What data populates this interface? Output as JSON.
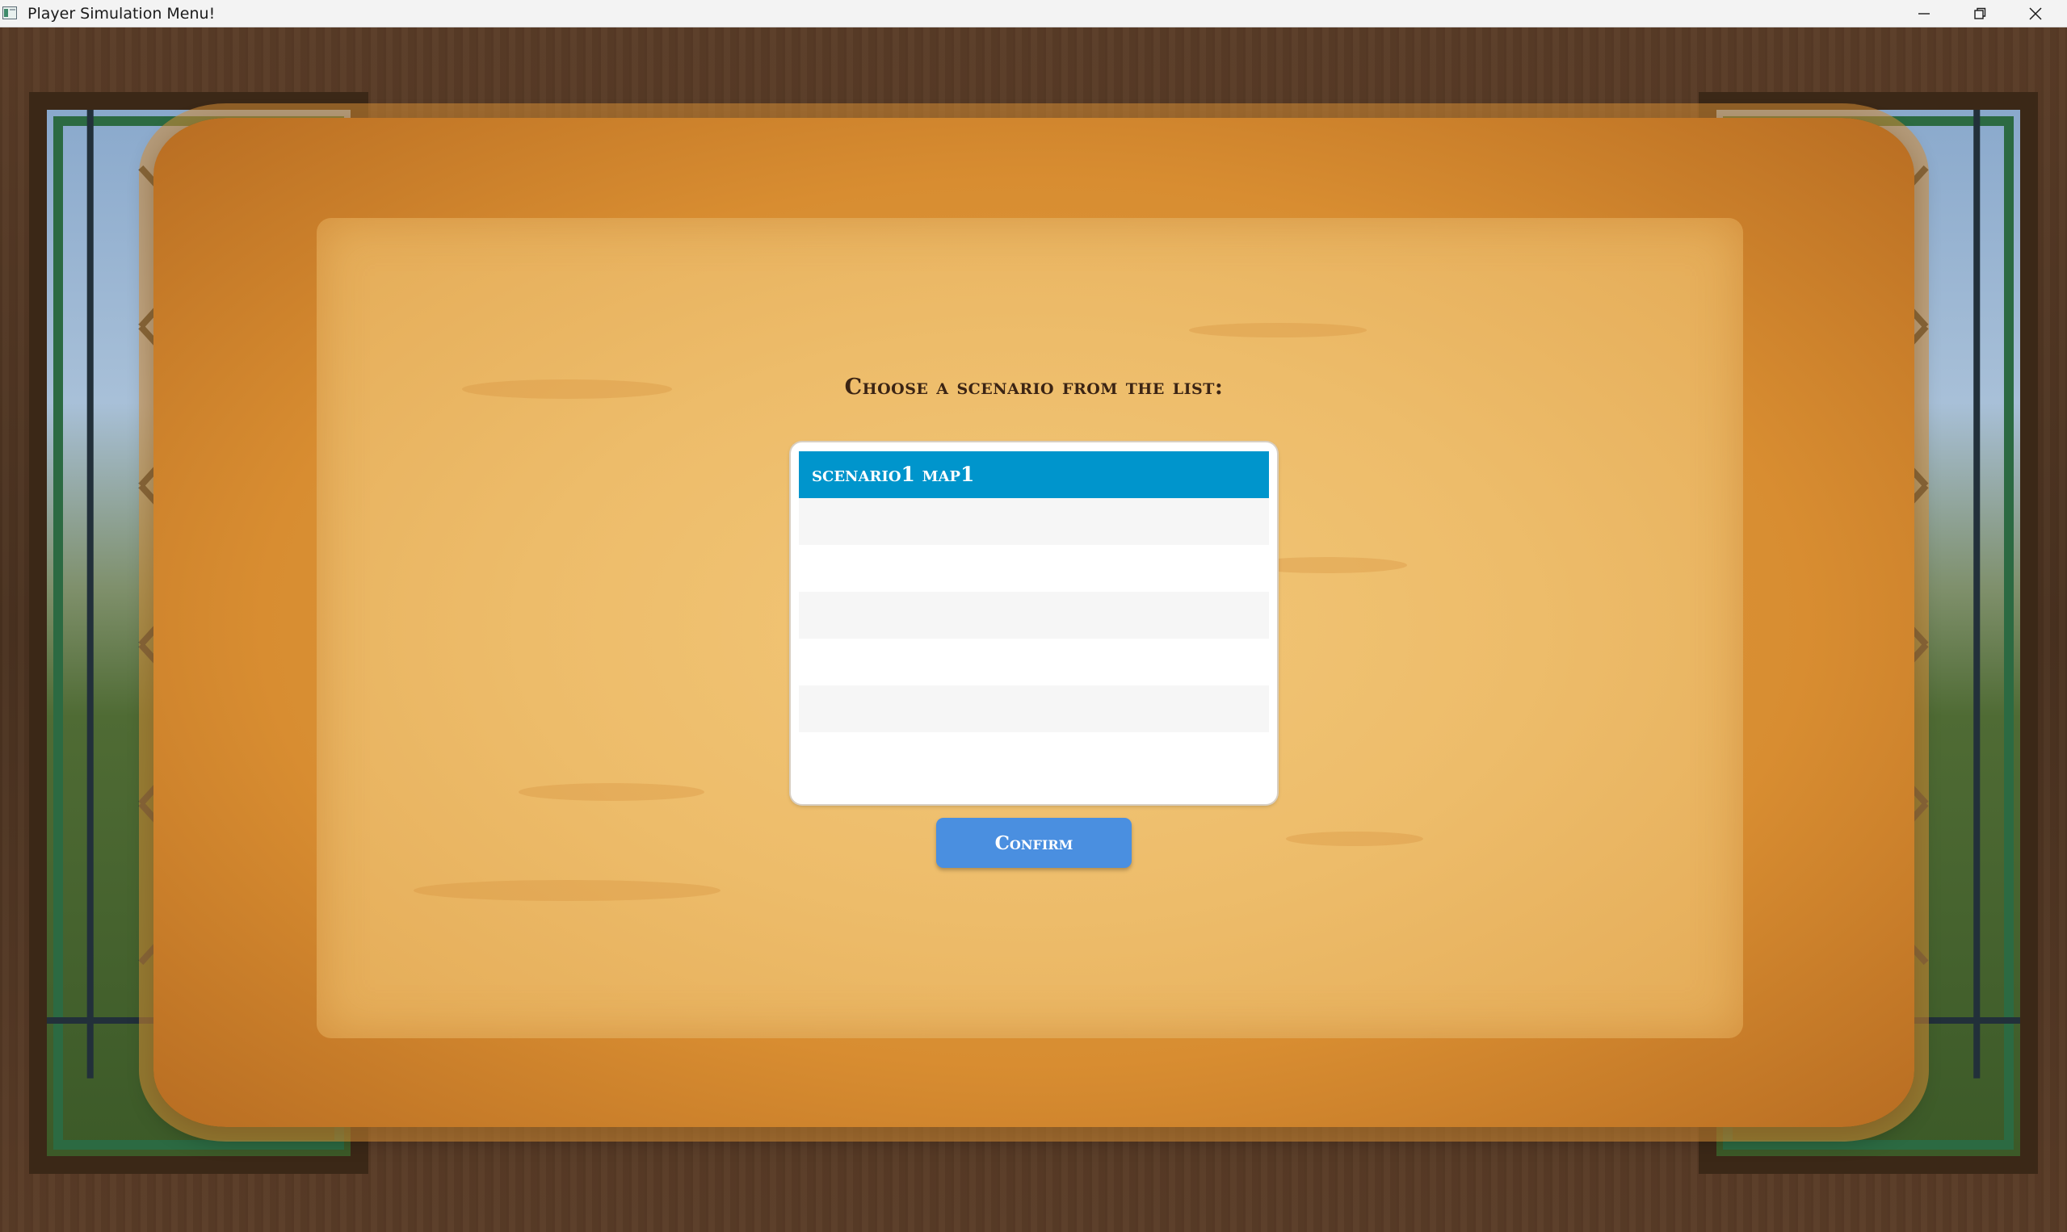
{
  "window": {
    "title": "Player Simulation Menu!",
    "icons": [
      "app-icon",
      "minimize-icon",
      "restore-icon",
      "close-icon"
    ]
  },
  "dialog": {
    "prompt": "Choose a scenario from the list:",
    "scenarios": [
      {
        "label": "scenario1 map1",
        "selected": true
      },
      {
        "label": ""
      },
      {
        "label": ""
      },
      {
        "label": ""
      },
      {
        "label": ""
      },
      {
        "label": ""
      },
      {
        "label": ""
      }
    ],
    "confirm_label": "Confirm"
  },
  "colors": {
    "selected_row": "#0095cc",
    "confirm_button": "#4a8fe0",
    "parchment": "#edbc6a",
    "wood": "#4a3220"
  }
}
